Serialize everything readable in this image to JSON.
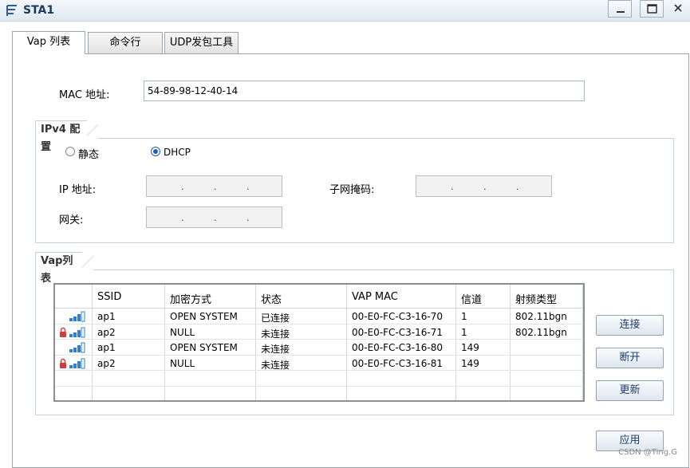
{
  "window": {
    "title": "STA1"
  },
  "tabs": [
    "Vap 列表",
    "命令行",
    "UDP发包工具"
  ],
  "mac": {
    "label": "MAC 地址:",
    "value": "54-89-98-12-40-14"
  },
  "ipv4": {
    "group_title": "IPv4 配置",
    "static_label": "静态",
    "dhcp_label": "DHCP",
    "selected": "DHCP",
    "ip_label": "IP 地址:",
    "mask_label": "子网掩码:",
    "gateway_label": "网关:",
    "ip_dot": "."
  },
  "vap": {
    "group_title": "Vap列表",
    "columns": [
      "SSID",
      "加密方式",
      "状态",
      "VAP MAC",
      "信道",
      "射频类型"
    ],
    "rows": [
      {
        "locked": false,
        "ssid": "ap1",
        "enc": "OPEN SYSTEM",
        "status": "已连接",
        "mac": "00-E0-FC-C3-16-70",
        "channel": "1",
        "radio": "802.11bgn"
      },
      {
        "locked": true,
        "ssid": "ap2",
        "enc": "NULL",
        "status": "未连接",
        "mac": "00-E0-FC-C3-16-71",
        "channel": "1",
        "radio": "802.11bgn"
      },
      {
        "locked": false,
        "ssid": "ap1",
        "enc": "OPEN SYSTEM",
        "status": "未连接",
        "mac": "00-E0-FC-C3-16-80",
        "channel": "149",
        "radio": ""
      },
      {
        "locked": true,
        "ssid": "ap2",
        "enc": "NULL",
        "status": "未连接",
        "mac": "00-E0-FC-C3-16-81",
        "channel": "149",
        "radio": ""
      }
    ]
  },
  "buttons": {
    "connect": "连接",
    "disconnect": "断开",
    "refresh": "更新",
    "apply": "应用"
  },
  "watermark": "CSDN @Ting.G",
  "colors": {
    "accent": "#1e5fb8",
    "signal": "#2f7fd8",
    "lock": "#d23b3b"
  }
}
